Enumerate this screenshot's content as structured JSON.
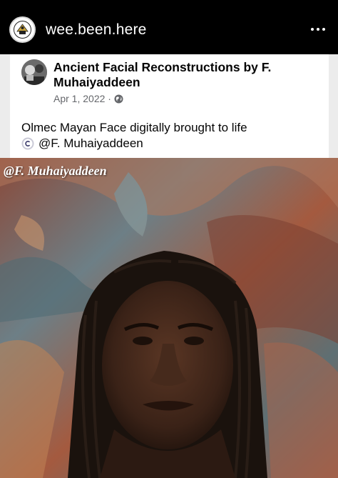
{
  "header": {
    "username": "wee.been.here",
    "more_icon": "more-dots-icon"
  },
  "post": {
    "page_name": "Ancient Facial Reconstructions by F. Muhaiyaddeen",
    "date": "Apr 1, 2022 ·",
    "visibility_icon": "globe-icon",
    "text_line1": "Olmec Mayan Face digitally brought to life",
    "copyright_icon": "copyright-icon",
    "credit": "@F. Muhaiyaddeen"
  },
  "photo": {
    "watermark": "@F. Muhaiyaddeen"
  },
  "colors": {
    "background": "#000000",
    "card": "#ffffff",
    "secondary_text": "#65676b"
  }
}
